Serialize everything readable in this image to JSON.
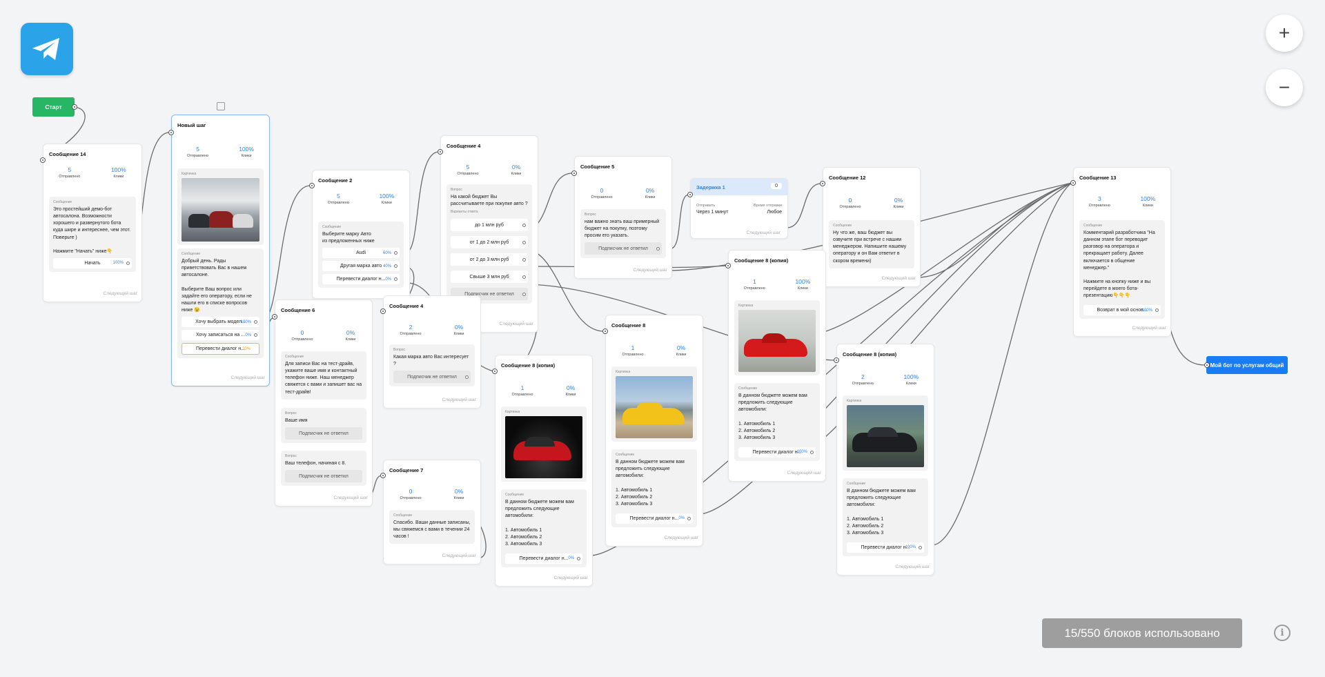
{
  "app": {
    "brand_icon": "telegram-icon",
    "brand_color": "#2aa3e8"
  },
  "zoom": {
    "zoom_in_label": "+",
    "zoom_out_label": "−"
  },
  "start": {
    "label": "Старт",
    "color": "#27b663"
  },
  "labels": {
    "sent": "Отправлено",
    "clicks": "Клики",
    "message": "Сообщение",
    "picture": "Картинка",
    "question": "Вопрос",
    "answers": "Варианты ответа",
    "next": "Следующий шаг",
    "no_answer": "Подписчик не ответил",
    "send": "Отправить",
    "send_time": "Время отправки"
  },
  "nodes": {
    "n14": {
      "title": "Сообщение 14",
      "sent": "5",
      "clicks": "100%",
      "message": "Это простейший демо-бот автосалона. Возможности хорошего и развернутого бота куда шире и интереснее, чем этот.\nПоверьте )\n\nНажмите \"Начать\" ниже👇",
      "button": "Начать",
      "button_pct": "100%"
    },
    "new": {
      "title": "Новый шаг",
      "sent": "5",
      "clicks": "100%",
      "message": "Добрый день. Рады приветствовать Вас в нашем автосалоне.\n\nВыберите Ваш вопрос или задайте его оператору, если не нашли его в списке вопросов ниже 😉",
      "buttons": [
        {
          "label": "Хочу выбрать модел...",
          "pct": "100%"
        },
        {
          "label": "Хочу записаться на ...",
          "pct": "0%"
        },
        {
          "label": "Перевести диалог н...",
          "pct": "20%"
        }
      ]
    },
    "n2": {
      "title": "Сообщение 2",
      "sent": "5",
      "clicks": "100%",
      "message": "Выберите марку Авто\nиз предложенных ниже",
      "buttons": [
        {
          "label": "Audi",
          "pct": "60%"
        },
        {
          "label": "Другая марка авто",
          "pct": "40%"
        },
        {
          "label": "Перевести диалог н...",
          "pct": "0%"
        }
      ]
    },
    "n4a": {
      "title": "Сообщение 4",
      "sent": "5",
      "clicks": "0%",
      "question": "На какой бюджет Вы рассчитываете при покупке авто ?",
      "answers": [
        "до 1 млн руб",
        "от 1 до 2 млн руб",
        "от 2 до 3 млн руб",
        "Свыше 3 млн руб"
      ]
    },
    "n5": {
      "title": "Сообщение 5",
      "sent": "0",
      "clicks": "0%",
      "question": "нам важно знать ваш примерный бюджет на покупку, поэтому просим его указать."
    },
    "delay": {
      "title": "Задержка 1",
      "badge": "0",
      "send_value": "Через 1 минут",
      "time_value": "Любое"
    },
    "n12": {
      "title": "Сообщение 12",
      "sent": "0",
      "clicks": "0%",
      "message": "Ну что же, ваш бюджет вы озвучите при встрече с нашим менеджером. Напишите нашему оператору и он Вам ответит в скором времени)"
    },
    "n13": {
      "title": "Сообщение 13",
      "sent": "3",
      "clicks": "100%",
      "message": "Комментарий разработчика \"На данном этапе бот переводит разговор на оператора и прекращает работу. Далее включается в общение менеджер.\"\n\nНажмите на кнопку ниже и вы перейдете в моего бота-презентацию👇👇👇",
      "button": "Возврат в мой основ...",
      "button_pct": "100%"
    },
    "n6": {
      "title": "Сообщение 6",
      "sent": "0",
      "clicks": "0%",
      "message": "Для записи Вас на тест-драйв, укажите ваше имя и контактный телефон ниже. Наш менеджер свяжется с вами и запишет вас на тест-драйв!",
      "q1": "Ваше имя",
      "q2": "Ваш телефон, начиная с 8."
    },
    "n4b": {
      "title": "Сообщение 4",
      "sent": "2",
      "clicks": "0%",
      "question": "Какая марка авто Вас интересует ?"
    },
    "n7": {
      "title": "Сообщение 7",
      "sent": "0",
      "clicks": "0%",
      "message": "Спасибо. Ваши данные записаны, мы свяжемся с вами в течении 24 часов !"
    },
    "n8c1": {
      "title": "Сообщение 8 (копия)",
      "sent": "1",
      "clicks": "0%",
      "message": "В данном бюджете можем вам предложить следующие автомобили:\n\n1. Автомобиль 1\n2. Автомобиль 2\n3. Автомобиль 3",
      "button": "Перевести диалог н...",
      "button_pct": "0%"
    },
    "n8": {
      "title": "Сообщение 8",
      "sent": "1",
      "clicks": "0%",
      "message": "В данном бюджете можем вам предложить следующие автомобили:\n\n1. Автомобиль 1\n2. Автомобиль 2\n3. Автомобиль 3",
      "button": "Перевести диалог н...",
      "button_pct": "0%"
    },
    "n8c2": {
      "title": "Сообщение 8 (копия)",
      "sent": "1",
      "clicks": "100%",
      "message": "В данном бюджете можем вам предложить следующие автомобили:\n\n1. Автомобиль 1\n2. Автомобиль 2\n3. Автомобиль 3",
      "button": "Перевести диалог н...",
      "button_pct": "100%"
    },
    "n8c3": {
      "title": "Сообщение 8 (копия)",
      "sent": "2",
      "clicks": "100%",
      "message": "В данном бюджете можем вам предложить следующие автомобили:\n\n1. Автомобиль 1\n2. Автомобиль 2\n3. Автомобиль 3",
      "button": "Перевести диалог н...",
      "button_pct": "100%"
    }
  },
  "final_button": {
    "label": "Мой бот по услугам общий",
    "color": "#1a7cf2"
  },
  "footer": {
    "usage": "15/550 блоков использовано",
    "info_icon": "info-icon"
  },
  "colors": {
    "accent": "#2d83ee",
    "wire": "#666666",
    "selected_border": "#8ab6ee"
  }
}
